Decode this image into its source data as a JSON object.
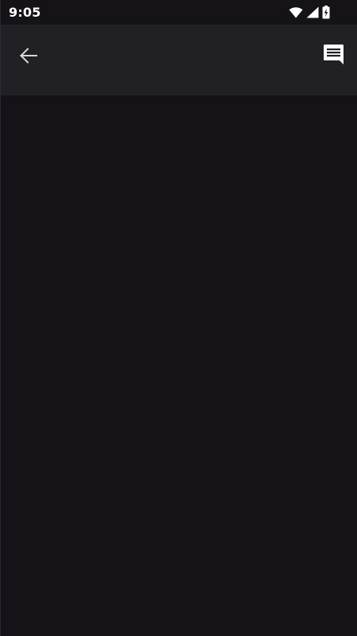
{
  "status_bar": {
    "time": "9:05",
    "icons": [
      "wifi-icon",
      "cellular-signal-icon",
      "battery-charging-icon"
    ]
  },
  "app_bar": {
    "back_icon": "arrow-back-icon",
    "action_icon": "chat-message-icon"
  },
  "colors": {
    "background": "#151318",
    "app_bar": "#212025",
    "icon": "#ffffff"
  }
}
